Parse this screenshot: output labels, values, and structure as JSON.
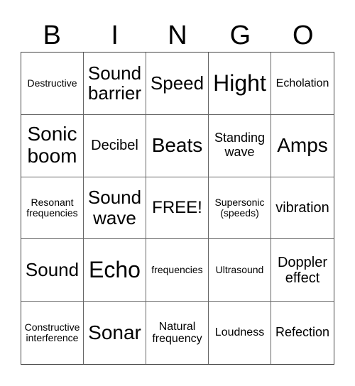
{
  "header": [
    "B",
    "I",
    "N",
    "G",
    "O"
  ],
  "cells": [
    "Destructive",
    "Sound barrier",
    "Speed",
    "Hight",
    "Echolation",
    "Sonic boom",
    "Decibel",
    "Beats",
    "Standing wave",
    "Amps",
    "Resonant frequencies",
    "Sound wave",
    "FREE!",
    "Supersonic (speeds)",
    "vibration",
    "Sound",
    "Echo",
    "frequencies",
    "Ultrasound",
    "Doppler effect",
    "Constructive interference",
    "Sonar",
    "Natural frequency",
    "Loudness",
    "Refection"
  ]
}
